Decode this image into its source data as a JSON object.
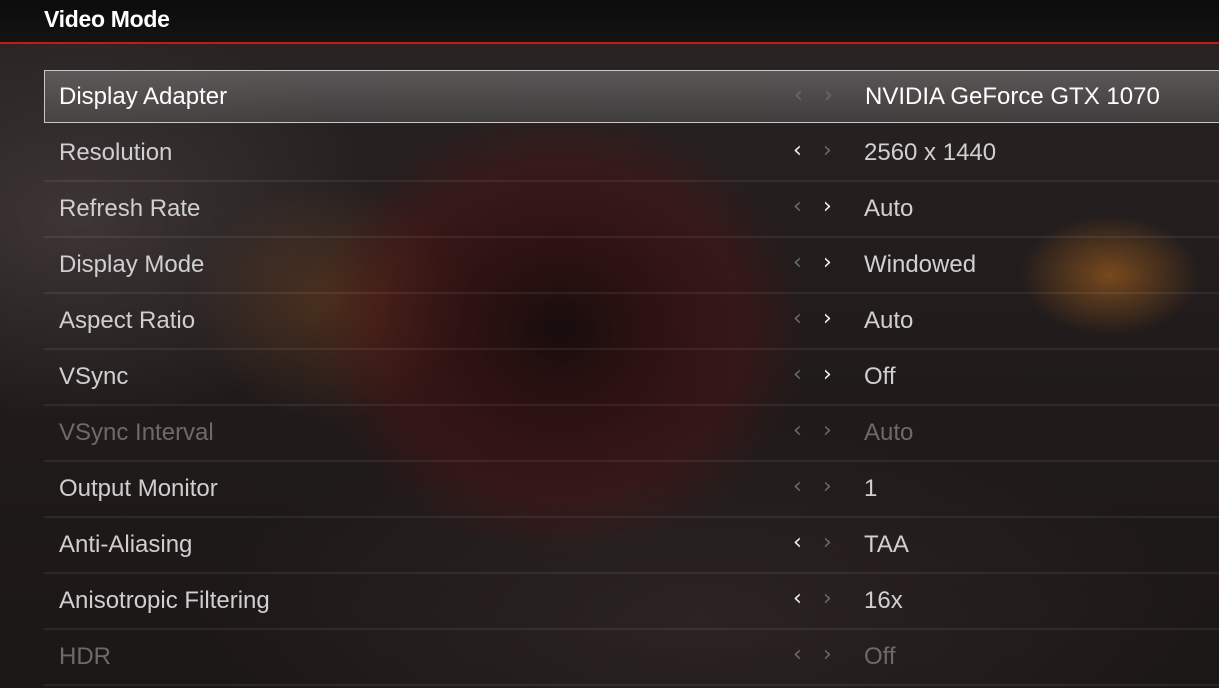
{
  "header": {
    "title": "Video Mode"
  },
  "settings": [
    {
      "label": "Display Adapter",
      "value": "NVIDIA GeForce GTX 1070",
      "left_active": false,
      "right_active": false,
      "selected": true,
      "disabled": false,
      "left_glyph": "‹",
      "right_glyph": "›"
    },
    {
      "label": "Resolution",
      "value": "2560 x 1440",
      "left_active": true,
      "right_active": false,
      "selected": false,
      "disabled": false,
      "left_glyph": "‹",
      "right_glyph": "›"
    },
    {
      "label": "Refresh Rate",
      "value": "Auto",
      "left_active": false,
      "right_active": true,
      "selected": false,
      "disabled": false,
      "left_glyph": "‹",
      "right_glyph": "›"
    },
    {
      "label": "Display Mode",
      "value": "Windowed",
      "left_active": false,
      "right_active": true,
      "selected": false,
      "disabled": false,
      "left_glyph": "‹",
      "right_glyph": "›"
    },
    {
      "label": "Aspect Ratio",
      "value": "Auto",
      "left_active": false,
      "right_active": true,
      "selected": false,
      "disabled": false,
      "left_glyph": "‹",
      "right_glyph": "›"
    },
    {
      "label": "VSync",
      "value": "Off",
      "left_active": false,
      "right_active": true,
      "selected": false,
      "disabled": false,
      "left_glyph": "‹",
      "right_glyph": "›"
    },
    {
      "label": "VSync Interval",
      "value": "Auto",
      "left_active": false,
      "right_active": false,
      "selected": false,
      "disabled": true,
      "left_glyph": "‹",
      "right_glyph": "›"
    },
    {
      "label": "Output Monitor",
      "value": "1",
      "left_active": false,
      "right_active": false,
      "selected": false,
      "disabled": false,
      "left_glyph": "‹",
      "right_glyph": "›"
    },
    {
      "label": "Anti-Aliasing",
      "value": "TAA",
      "left_active": true,
      "right_active": false,
      "selected": false,
      "disabled": false,
      "left_glyph": "‹",
      "right_glyph": "›"
    },
    {
      "label": "Anisotropic Filtering",
      "value": "16x",
      "left_active": true,
      "right_active": false,
      "selected": false,
      "disabled": false,
      "left_glyph": "‹",
      "right_glyph": "›"
    },
    {
      "label": "HDR",
      "value": "Off",
      "left_active": false,
      "right_active": false,
      "selected": false,
      "disabled": true,
      "left_glyph": "‹",
      "right_glyph": "›"
    }
  ],
  "colors": {
    "accent_red": "#c21a1a",
    "header_bg": "#0b0b0b",
    "arrow_active": "#f2f2f2",
    "arrow_inactive": "#6a6a6a"
  },
  "icons": {
    "prev": "chevron-left-icon",
    "next": "chevron-right-icon"
  }
}
